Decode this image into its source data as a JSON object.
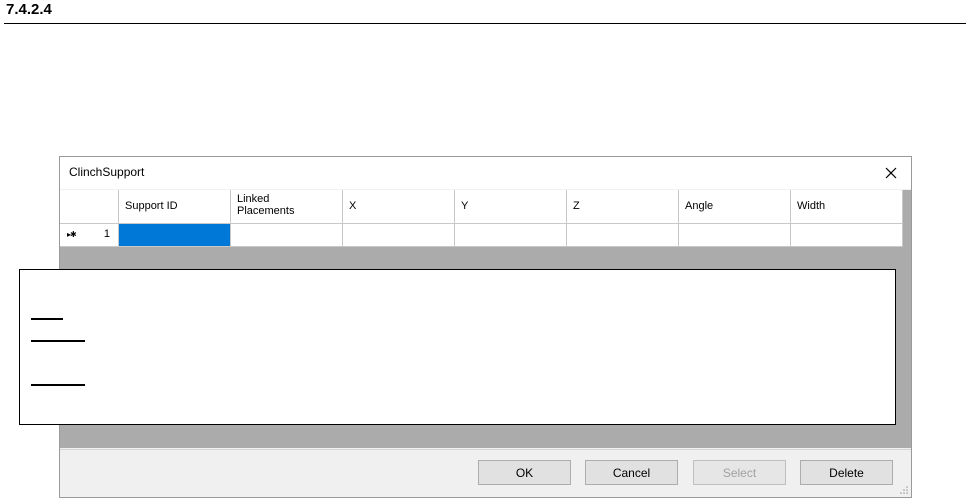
{
  "section": {
    "number": "7.4.2.4"
  },
  "dialog": {
    "title": "ClinchSupport",
    "close_glyph": "✕",
    "columns": [
      {
        "label": "Support ID"
      },
      {
        "label": "Linked\nPlacements"
      },
      {
        "label": "X"
      },
      {
        "label": "Y"
      },
      {
        "label": "Z"
      },
      {
        "label": "Angle"
      },
      {
        "label": "Width"
      }
    ],
    "rows": [
      {
        "marker": "▸✱",
        "number": "1"
      }
    ],
    "buttons": {
      "ok": "OK",
      "cancel": "Cancel",
      "select": "Select",
      "delete": "Delete"
    }
  }
}
